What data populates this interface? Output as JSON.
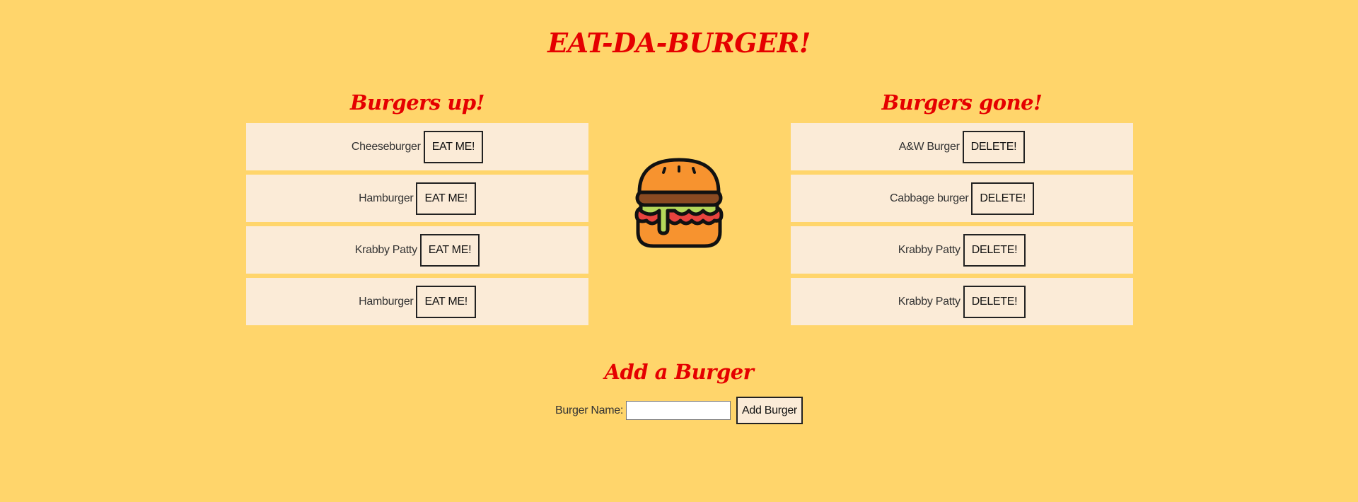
{
  "header": {
    "title": "EAT-DA-BURGER!"
  },
  "burgers_up": {
    "title": "Burgers up!",
    "items": [
      {
        "name": "Cheeseburger",
        "action": "EAT ME!"
      },
      {
        "name": "Hamburger",
        "action": "EAT ME!"
      },
      {
        "name": "Krabby Patty",
        "action": "EAT ME!"
      },
      {
        "name": "Hamburger",
        "action": "EAT ME!"
      }
    ]
  },
  "burgers_gone": {
    "title": "Burgers gone!",
    "items": [
      {
        "name": "A&W Burger",
        "action": "DELETE!"
      },
      {
        "name": "Cabbage burger",
        "action": "DELETE!"
      },
      {
        "name": "Krabby Patty",
        "action": "DELETE!"
      },
      {
        "name": "Krabby Patty",
        "action": "DELETE!"
      }
    ]
  },
  "logo": {
    "icon": "burger-icon"
  },
  "add_burger": {
    "title": "Add a Burger",
    "label": "Burger Name:",
    "input_value": "",
    "button_label": "Add Burger"
  },
  "colors": {
    "background": "#ffd56b",
    "card": "#fbebd7",
    "heading": "#e50000"
  }
}
